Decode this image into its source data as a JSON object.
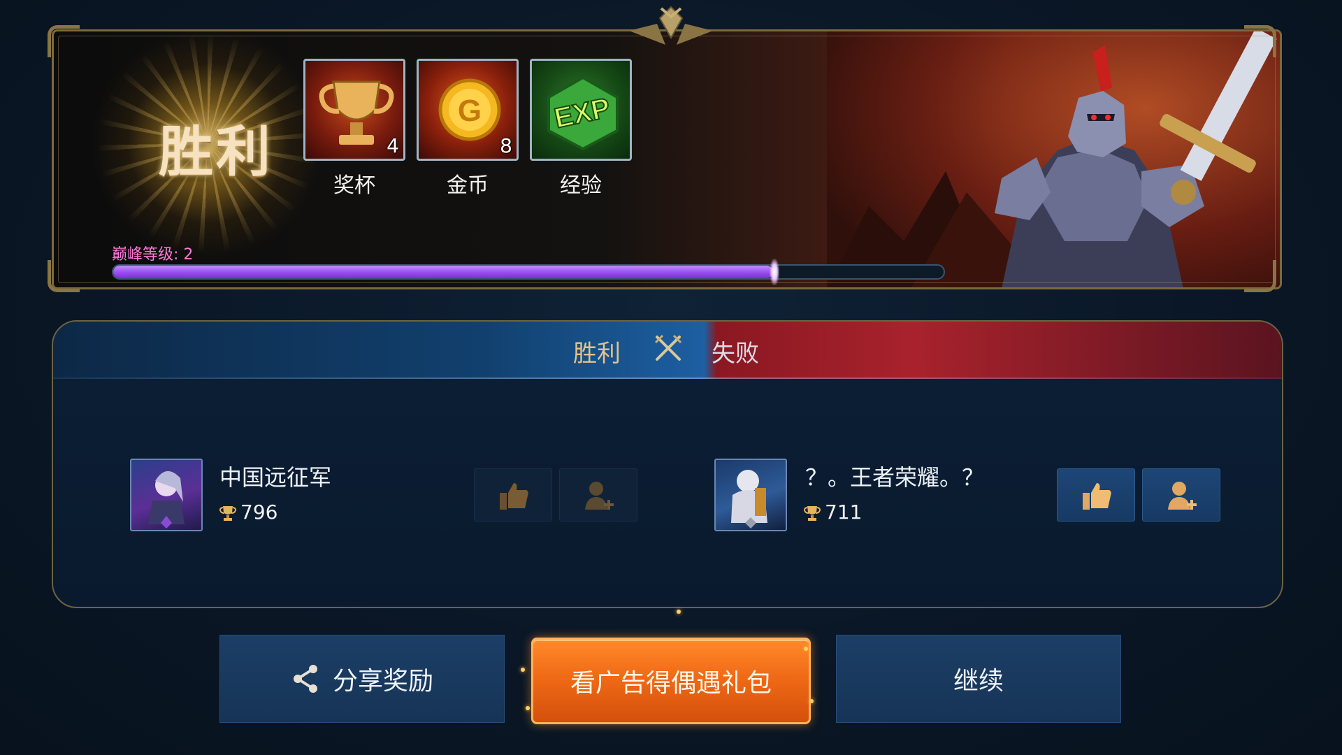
{
  "banner": {
    "title": "胜利",
    "rewards": [
      {
        "icon": "trophy-icon",
        "count": "4",
        "label": "奖杯"
      },
      {
        "icon": "gold-coin-icon",
        "count": "8",
        "label": "金币"
      },
      {
        "icon": "exp-icon",
        "count": "",
        "label": "经验"
      }
    ],
    "peak_level_label": "巅峰等级: 2",
    "peak_progress": 0.795
  },
  "result": {
    "win_label": "胜利",
    "lose_label": "失败",
    "players": [
      {
        "name": "中国远征军",
        "trophies": "796"
      },
      {
        "name": "？。王者荣耀。？",
        "trophies": "711"
      }
    ]
  },
  "buttons": {
    "share": "分享奖励",
    "watch_ad": "看广告得偶遇礼包",
    "continue": "继续"
  },
  "colors": {
    "progress": "#9a4cf0",
    "peak_text": "#ff7ad6",
    "ad_button": "#f06a16",
    "win_side": "#1d5fa2",
    "lose_side": "#a8222c"
  }
}
